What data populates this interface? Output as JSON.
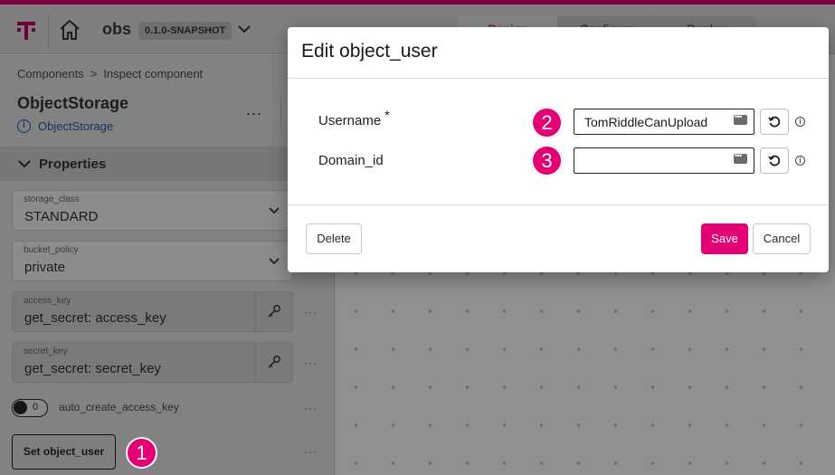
{
  "topbar": {
    "logo": "T",
    "app_name": "obs",
    "version": "0.1.0-SNAPSHOT",
    "tabs": [
      {
        "label": "Design",
        "active": true
      },
      {
        "label": "Configure",
        "active": false
      },
      {
        "label": "Deploy",
        "active": false
      }
    ]
  },
  "breadcrumb": {
    "items": [
      "Components",
      "Inspect component"
    ],
    "separator": ">"
  },
  "component": {
    "title": "ObjectStorage",
    "type_link": "ObjectStorage",
    "menu_glyph": "..."
  },
  "properties": {
    "header": "Properties",
    "fields": [
      {
        "label": "storage_class",
        "value": "STANDARD"
      },
      {
        "label": "bucket_policy",
        "value": "private"
      },
      {
        "label": "access_key",
        "value": "get_secret: access_key"
      },
      {
        "label": "secret_key",
        "value": "get_secret: secret_key"
      }
    ],
    "toggle": {
      "value": "0",
      "label": "auto_create_access_key"
    },
    "set_button": "Set object_user",
    "row_menu": "···"
  },
  "badges": [
    "1",
    "2",
    "3"
  ],
  "modal": {
    "title": "Edit object_user",
    "fields": [
      {
        "label": "Username",
        "required_mark": "*",
        "value": "TomRiddleCanUpload",
        "info": "i"
      },
      {
        "label": "Domain_id",
        "value": "",
        "info": "i"
      }
    ],
    "delete_label": "Delete",
    "save_label": "Save",
    "cancel_label": "Cancel"
  },
  "colors": {
    "accent": "#e20074",
    "overlay_top_stripe": "#7a0046"
  }
}
